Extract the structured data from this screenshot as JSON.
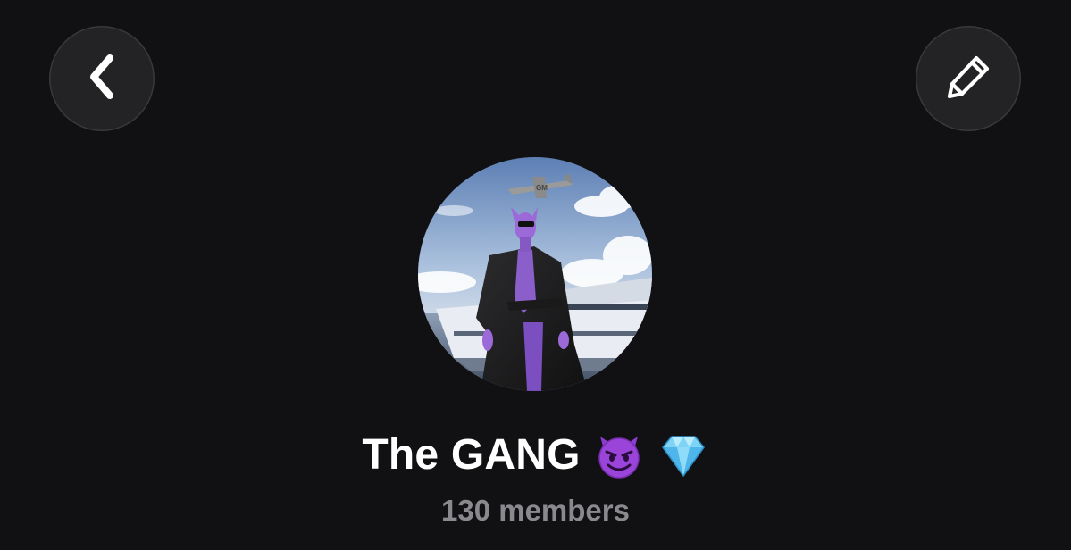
{
  "header": {
    "back_icon": "chevron-left-icon",
    "edit_icon": "pencil-icon"
  },
  "profile": {
    "avatar_description": "group-avatar",
    "name": "The GANG",
    "name_emojis": [
      "smiling-imp-emoji",
      "gem-emoji"
    ],
    "members_text": "130 members"
  },
  "colors": {
    "background": "#111113",
    "button_bg": "#232325",
    "title": "#ffffff",
    "subtitle": "#8a8a8e"
  }
}
